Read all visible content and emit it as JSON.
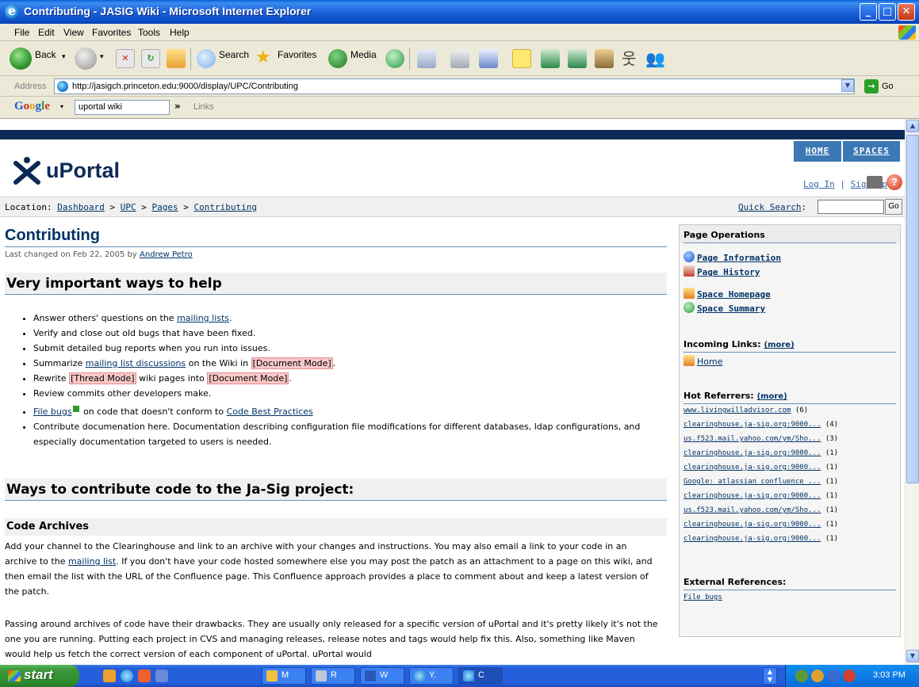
{
  "window": {
    "title": "Contributing - JASIG Wiki - Microsoft Internet Explorer",
    "minimize": "_",
    "maximize": "□",
    "close": "✕"
  },
  "menu": [
    "File",
    "Edit",
    "View",
    "Favorites",
    "Tools",
    "Help"
  ],
  "toolbar": {
    "back": "Back",
    "search": "Search",
    "favorites": "Favorites",
    "media": "Media"
  },
  "address": {
    "label": "Address",
    "url": "http://jasigch.princeton.edu:9000/display/UPC/Contributing",
    "go": "Go"
  },
  "google": {
    "logo": "Google",
    "query": "uportal wiki",
    "chevron": "»",
    "links": "Links"
  },
  "site": {
    "logo": "uPortal",
    "tabs": {
      "home": "HOME",
      "spaces": "SPACES"
    },
    "login": "Log In",
    "sep": "|",
    "signup": "Sign Up",
    "location_label": "Location:",
    "breadcrumb": [
      "Dashboard",
      "UPC",
      "Pages",
      "Contributing"
    ],
    "breadcrumb_sep": ">",
    "quick_search_label": "Quick Search",
    "quick_search_colon": ":",
    "quick_search_go": "Go"
  },
  "page": {
    "title": "Contributing",
    "last_changed_prefix": "Last changed on Feb 22, 2005 by",
    "author": "Andrew Petro",
    "h_important": "Very important ways to help",
    "bullets": {
      "b1_pre": "Answer others' questions on the",
      "b1_link": "mailing lists",
      "b1_post": ".",
      "b2": "Verify and close out old bugs that have been fixed.",
      "b3": "Submit detailed bug reports when you run into issues.",
      "b4_pre": "Summarize",
      "b4_link": "mailing list discussions",
      "b4_mid": "on the Wiki in",
      "b4_hl": "[Document Mode]",
      "b4_post": ".",
      "b5_pre": "Rewrite",
      "b5_hl1": "[Thread Mode]",
      "b5_mid": "wiki pages into",
      "b5_hl2": "[Document Mode]",
      "b5_post": ".",
      "b6": "Review commits other developers make.",
      "b7_link": "File bugs",
      "b7_mid": "on code that doesn't conform to",
      "b7_link2": "Code Best Practices",
      "b8": "Contribute documenation here. Documentation describing configuration file modifications for different databases, ldap configurations, and especially documentation targeted to users is needed."
    },
    "h_code": "Ways to contribute code to the Ja-Sig project:",
    "h_archives": "Code Archives",
    "p1_pre": "Add your channel to the Clearinghouse and link to an archive with your changes and instructions. You may also email a link to your code in an archive to the",
    "p1_link": "mailing list",
    "p1_post": ". If you don't have your code hosted somewhere else you may post the patch as an attachment to a page on this wiki, and then email the list with the URL of the Confluence page. This Confluence approach provides a place to comment about and keep a latest version of the patch.",
    "p2": "Passing around archives of code have their drawbacks. They are usually only released for a specific version of uPortal and it's pretty likely it's not the one you are running. Putting each project in CVS and managing releases, release notes and tags would help fix this. Also, something like Maven would help us fetch the correct version of each component of uPortal. uPortal would"
  },
  "sidebar": {
    "ops_title": "Page Operations",
    "ops": [
      "Page Information",
      "Page History",
      "Space Homepage",
      "Space Summary"
    ],
    "incoming_title": "Incoming Links:",
    "more": "(more)",
    "incoming": [
      "Home"
    ],
    "hot_title": "Hot Referrers:",
    "hot": [
      {
        "link": "www.livingwilladvisor.com",
        "count": "(6)"
      },
      {
        "link": "clearinghouse.ja-sig.org:9000...",
        "count": "(4)"
      },
      {
        "link": "us.f523.mail.yahoo.com/ym/Sho...",
        "count": "(3)"
      },
      {
        "link": "clearinghouse.ja-sig.org:9000...",
        "count": "(1)"
      },
      {
        "link": "clearinghouse.ja-sig.org:9000...",
        "count": "(1)"
      },
      {
        "link": "Google: atlassian confluence ...",
        "count": "(1)"
      },
      {
        "link": "clearinghouse.ja-sig.org:9000...",
        "count": "(1)"
      },
      {
        "link": "us.f523.mail.yahoo.com/ym/Sho...",
        "count": "(1)"
      },
      {
        "link": "clearinghouse.ja-sig.org:9000...",
        "count": "(1)"
      },
      {
        "link": "clearinghouse.ja-sig.org:9000...",
        "count": "(1)"
      }
    ],
    "ext_title": "External References:",
    "ext": [
      "File bugs"
    ]
  },
  "taskbar": {
    "start": "start",
    "tasks": [
      "M",
      "R",
      "W",
      "Y.",
      "C"
    ],
    "clock": "3:03 PM"
  },
  "colors": {
    "title_blue": "#0b4cc8",
    "link": "#003366",
    "tab": "#3c78b4",
    "highlight": "#f8c8c8"
  }
}
